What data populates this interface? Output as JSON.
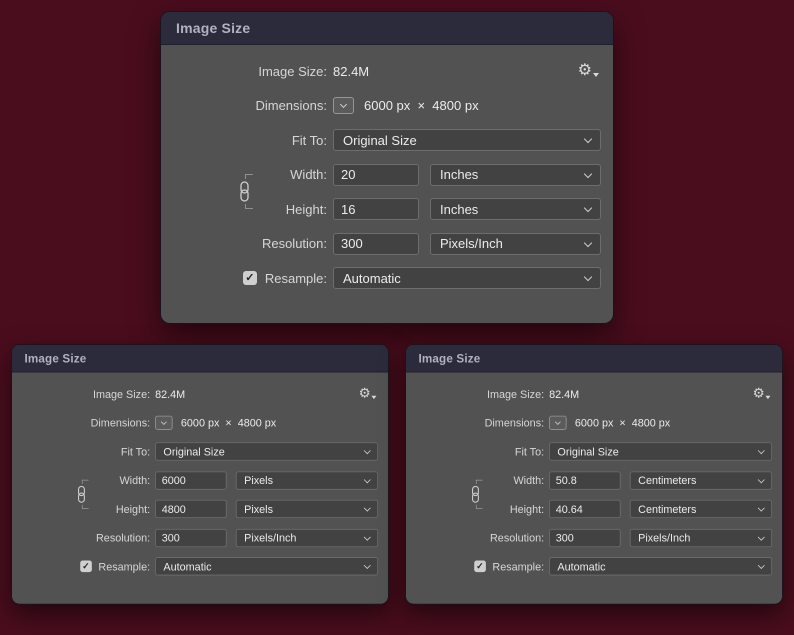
{
  "colors": {
    "page_bg": "#4a0d1d",
    "dialog_bg": "#525252",
    "titlebar_bg": "#2c2b3b",
    "field_bg": "#424242",
    "field_border": "#6d6d6d",
    "text": "#ececec",
    "label_text": "#d6d6d6",
    "title_text": "#b3b1c0"
  },
  "icons": {
    "gear": "⚙",
    "check": "✓",
    "chevron_down": "chevron-down",
    "chain_link": "chain-link"
  },
  "labels": {
    "image_size": "Image Size:",
    "dimensions": "Dimensions:",
    "fit_to": "Fit To:",
    "width": "Width:",
    "height": "Height:",
    "resolution": "Resolution:",
    "resample": "Resample:"
  },
  "dialogs": [
    {
      "title": "Image Size",
      "image_size": "82.4M",
      "dimensions": "6000 px  ×  4800 px",
      "fit_to": "Original Size",
      "width": "20",
      "width_unit": "Inches",
      "height": "16",
      "height_unit": "Inches",
      "resolution": "300",
      "resolution_unit": "Pixels/Inch",
      "resample": "Automatic",
      "resample_checked": true
    },
    {
      "title": "Image Size",
      "image_size": "82.4M",
      "dimensions": "6000 px  ×  4800 px",
      "fit_to": "Original Size",
      "width": "6000",
      "width_unit": "Pixels",
      "height": "4800",
      "height_unit": "Pixels",
      "resolution": "300",
      "resolution_unit": "Pixels/Inch",
      "resample": "Automatic",
      "resample_checked": true
    },
    {
      "title": "Image Size",
      "image_size": "82.4M",
      "dimensions": "6000 px  ×  4800 px",
      "fit_to": "Original Size",
      "width": "50.8",
      "width_unit": "Centimeters",
      "height": "40.64",
      "height_unit": "Centimeters",
      "resolution": "300",
      "resolution_unit": "Pixels/Inch",
      "resample": "Automatic",
      "resample_checked": true
    }
  ]
}
